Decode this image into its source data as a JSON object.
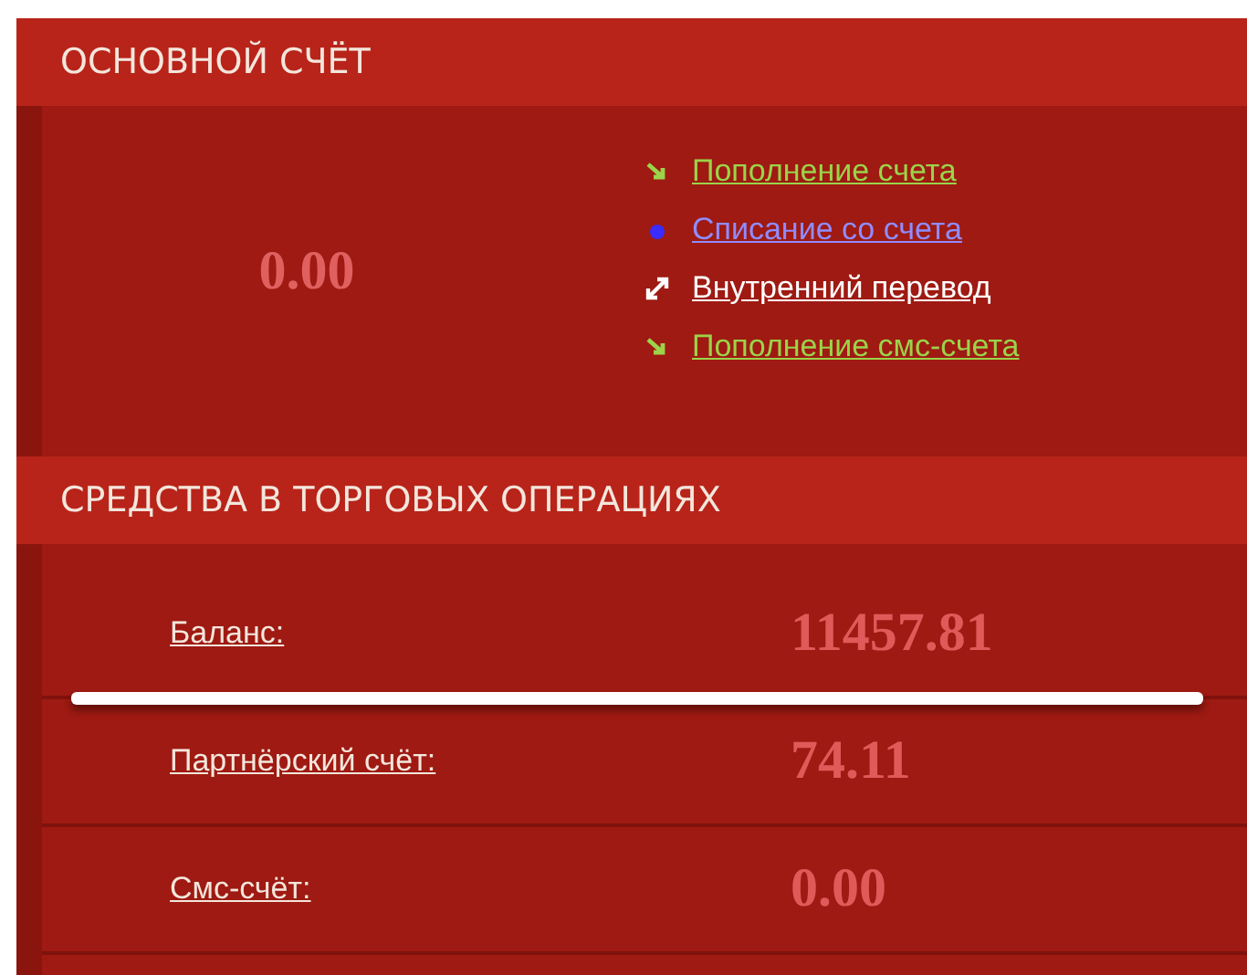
{
  "main_account": {
    "title": "ОСНОВНОЙ СЧЁТ",
    "balance": "0.00",
    "links": [
      {
        "label": "Пополнение счета",
        "kind": "deposit",
        "color": "#9bd34a"
      },
      {
        "label": "Списание со счета",
        "kind": "withdraw",
        "color": "#8f8cff"
      },
      {
        "label": "Внутренний перевод",
        "kind": "transfer",
        "color": "#ffffff"
      },
      {
        "label": "Пополнение смс-счета",
        "kind": "deposit",
        "color": "#9bd34a"
      }
    ]
  },
  "trading_funds": {
    "title": "СРЕДСТВА В ТОРГОВЫХ ОПЕРАЦИЯХ",
    "rows": [
      {
        "label": "Баланс:",
        "value": "11457.81",
        "highlighted": true
      },
      {
        "label": "Партнёрский счёт:",
        "value": "74.11",
        "highlighted": false
      },
      {
        "label": "Смс-счёт:",
        "value": "0.00",
        "highlighted": false
      }
    ]
  }
}
